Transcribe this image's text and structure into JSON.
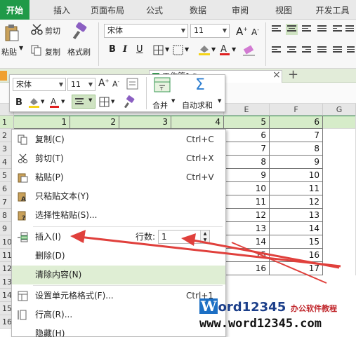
{
  "ribbon_tabs": [
    "开始",
    "插入",
    "页面布局",
    "公式",
    "数据",
    "审阅",
    "视图",
    "开发工具"
  ],
  "ribbon": {
    "cut": "剪切",
    "paste": "粘贴",
    "copy": "复制",
    "format_painter": "格式刷",
    "font": "宋体",
    "size": "11",
    "bold": "B",
    "italic": "I",
    "underline": "U"
  },
  "doc_tab": "工作簿1 *",
  "columns": [
    "E",
    "F",
    "G"
  ],
  "rows": [
    "1",
    "2",
    "3",
    "4",
    "5",
    "6",
    "7",
    "8",
    "9",
    "10",
    "11",
    "12",
    "13",
    "14",
    "15",
    "16"
  ],
  "row1_values": [
    "1",
    "2",
    "3",
    "4",
    "5",
    "6"
  ],
  "col_e": [
    "6",
    "7",
    "8",
    "9",
    "10",
    "11",
    "12",
    "13",
    "14",
    "15",
    "16"
  ],
  "col_f": [
    "7",
    "8",
    "9",
    "10",
    "11",
    "12",
    "13",
    "14",
    "15",
    "16",
    "17"
  ],
  "mini_toolbar": {
    "font": "宋体",
    "size": "11",
    "bold": "B",
    "merge": "合并",
    "autosum": "自动求和"
  },
  "context_menu": {
    "copy": "复制(C)",
    "copy_key": "Ctrl+C",
    "cut": "剪切(T)",
    "cut_key": "Ctrl+X",
    "paste": "粘贴(P)",
    "paste_key": "Ctrl+V",
    "paste_text": "只粘贴文本(Y)",
    "paste_special": "选择性粘贴(S)...",
    "insert": "插入(I)",
    "rows_label": "行数:",
    "rows_value": "1",
    "delete": "删除(D)",
    "clear": "清除内容(N)",
    "format_cells": "设置单元格格式(F)...",
    "format_cells_key": "Ctrl+1",
    "row_height": "行高(R)...",
    "hide": "隐藏(H)"
  },
  "watermark": {
    "brand_w": "W",
    "brand_rest": "ord12345",
    "tagline": "办公软件教程",
    "url": "www.word12345.com"
  },
  "colors": {
    "accent": "#1f9a48",
    "selection": "#d6ecc9",
    "arrow": "#e0403c"
  }
}
